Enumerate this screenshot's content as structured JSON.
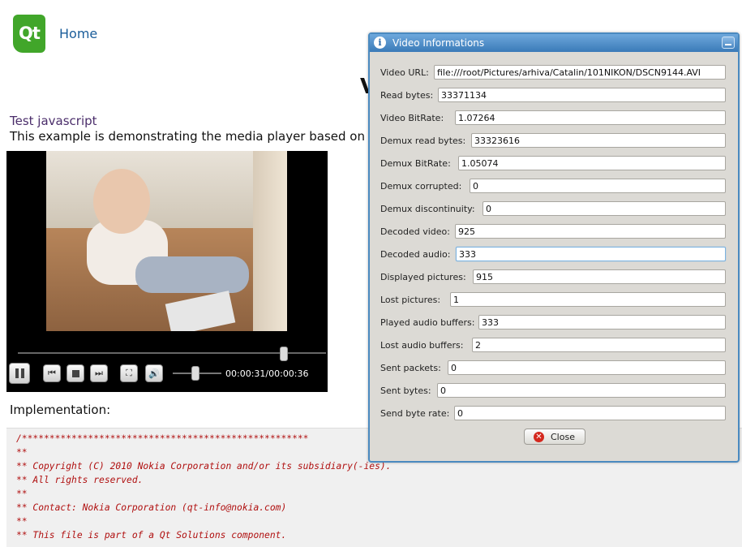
{
  "page": {
    "logo_text": "Qt",
    "home_link": "Home",
    "heading_fragment": "V",
    "test_link": "Test javascript",
    "intro": "This example is demonstrating the media player based on VLC.",
    "implementation_label": "Implementation:"
  },
  "player": {
    "time": "00:00:31/00:00:36",
    "seek_fraction": 0.86,
    "volume_fraction": 0.45
  },
  "code": {
    "lines": [
      "/****************************************************",
      "**",
      "** Copyright (C) 2010 Nokia Corporation and/or its subsidiary(-ies).",
      "** All rights reserved.",
      "**",
      "** Contact: Nokia Corporation (qt-info@nokia.com)",
      "**",
      "** This file is part of a Qt Solutions component."
    ]
  },
  "dialog": {
    "title": "Video Informations",
    "rows": [
      {
        "label": "Video URL:",
        "value": "file:///root/Pictures/arhiva/Catalin/101NIKON/DSCN9144.AVI"
      },
      {
        "label": "Read bytes:",
        "value": "33371134"
      },
      {
        "label": "Video BitRate:",
        "value": "1.07264"
      },
      {
        "label": "Demux read bytes:",
        "value": "33323616"
      },
      {
        "label": "Demux BitRate:",
        "value": "1.05074"
      },
      {
        "label": "Demux corrupted:",
        "value": "0"
      },
      {
        "label": "Demux discontinuity:",
        "value": "0"
      },
      {
        "label": "Decoded video:",
        "value": "925"
      },
      {
        "label": "Decoded audio:",
        "value": "333"
      },
      {
        "label": "Displayed pictures:",
        "value": "915"
      },
      {
        "label": "Lost pictures:",
        "value": "1"
      },
      {
        "label": "Played audio buffers:",
        "value": "333"
      },
      {
        "label": "Lost audio buffers:",
        "value": "2"
      },
      {
        "label": "Sent packets:",
        "value": "0"
      },
      {
        "label": "Sent bytes:",
        "value": "0"
      },
      {
        "label": "Send byte rate:",
        "value": "0"
      }
    ],
    "close_label": "Close"
  }
}
